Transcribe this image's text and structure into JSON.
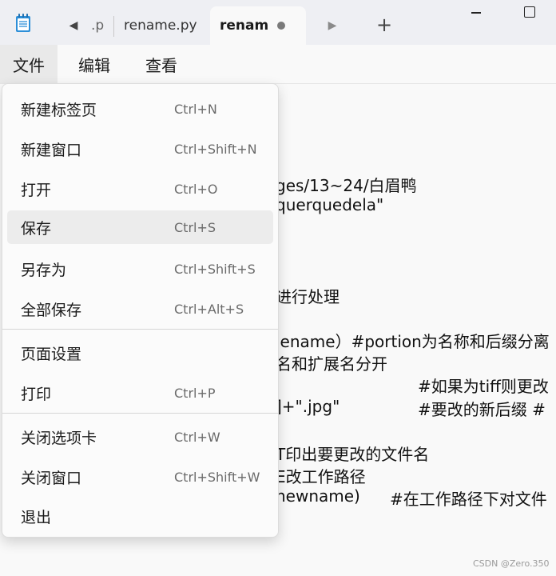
{
  "tabs": {
    "partial_label": ".p",
    "rename_label": "rename.py",
    "active_label": "renam"
  },
  "menubar": {
    "file": "文件",
    "edit": "编辑",
    "view": "查看"
  },
  "editor_lines": [
    "ges/13~24/白眉鸭",
    "querquedela\"",
    "进行处理",
    "lename）#portion为名称和后缀分离",
    "名和扩展名分开",
    "#如果为tiff则更改",
    "]+\".jpg\"",
    "#要改的新后缀 #",
    "T印出要更改的文件名",
    "E改工作路径",
    "newname)",
    "#在工作路径下对文件"
  ],
  "file_menu": {
    "items": [
      {
        "label": "新建标签页",
        "shortcut": "Ctrl+N"
      },
      {
        "label": "新建窗口",
        "shortcut": "Ctrl+Shift+N"
      },
      {
        "label": "打开",
        "shortcut": "Ctrl+O"
      },
      {
        "label": "保存",
        "shortcut": "Ctrl+S",
        "highlighted": true
      },
      {
        "label": "另存为",
        "shortcut": "Ctrl+Shift+S"
      },
      {
        "label": "全部保存",
        "shortcut": "Ctrl+Alt+S"
      },
      {
        "label": "页面设置",
        "shortcut": ""
      },
      {
        "label": "打印",
        "shortcut": "Ctrl+P"
      },
      {
        "label": "关闭选项卡",
        "shortcut": "Ctrl+W"
      },
      {
        "label": "关闭窗口",
        "shortcut": "Ctrl+Shift+W"
      },
      {
        "label": "退出",
        "shortcut": ""
      }
    ]
  },
  "watermark": "CSDN @Zero.350",
  "icons": {
    "app": "notepad-icon",
    "prev": "chevron-left-icon",
    "next": "chevron-right-icon",
    "new_tab": "plus-icon",
    "minimize": "minimize-icon",
    "maximize": "maximize-icon",
    "unsaved": "unsaved-dot-icon"
  },
  "colors": {
    "titlebar": "#eeeff3",
    "background": "#f9f9f9",
    "menu_highlight": "#ececec"
  }
}
